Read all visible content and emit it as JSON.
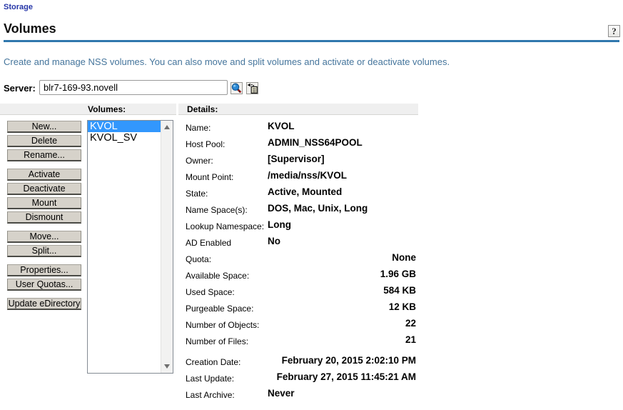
{
  "page": {
    "breadcrumb": "Storage",
    "title": "Volumes",
    "help_label": "?",
    "description": "Create and manage NSS volumes. You can also move and split volumes and activate or deactivate volumes."
  },
  "server": {
    "label": "Server:",
    "value": "blr7-169-93.novell",
    "search_icon": "magnifier-object-selector-icon",
    "history_icon": "object-history-icon"
  },
  "panel": {
    "volumes_header": "Volumes:",
    "details_header": "Details:"
  },
  "actions": {
    "groups": [
      [
        "New...",
        "Delete",
        "Rename..."
      ],
      [
        "Activate",
        "Deactivate",
        "Mount",
        "Dismount"
      ],
      [
        "Move...",
        "Split..."
      ],
      [
        "Properties...",
        "User Quotas..."
      ],
      [
        "Update eDirectory"
      ]
    ]
  },
  "volume_list": {
    "items": [
      {
        "name": "KVOL",
        "selected": true
      },
      {
        "name": "KVOL_SV",
        "selected": false
      }
    ]
  },
  "details": {
    "rows": [
      {
        "label": "Name:",
        "value": "KVOL",
        "align": "left"
      },
      {
        "label": "Host Pool:",
        "value": "ADMIN_NSS64POOL",
        "align": "left"
      },
      {
        "label": "Owner:",
        "value": "[Supervisor]",
        "align": "left"
      },
      {
        "label": "Mount Point:",
        "value": "/media/nss/KVOL",
        "align": "left"
      },
      {
        "label": "State:",
        "value": "Active, Mounted",
        "align": "left"
      },
      {
        "label": "Name Space(s):",
        "value": "DOS, Mac, Unix, Long",
        "align": "left"
      },
      {
        "label": "Lookup Namespace:",
        "value": "Long",
        "align": "left"
      },
      {
        "label": "AD Enabled",
        "value": "No",
        "align": "left"
      },
      {
        "label": "Quota:",
        "value": "None",
        "align": "right"
      },
      {
        "label": "Available Space:",
        "value": "1.96 GB",
        "align": "right"
      },
      {
        "label": "Used Space:",
        "value": "584 KB",
        "align": "right"
      },
      {
        "label": "Purgeable Space:",
        "value": "12 KB",
        "align": "right"
      },
      {
        "label": "Number of Objects:",
        "value": "22",
        "align": "right"
      },
      {
        "label": "Number of Files:",
        "value": "21",
        "align": "right"
      },
      {
        "label": "Creation Date:",
        "value": "February 20, 2015 2:02:10 PM",
        "align": "right",
        "gap": true
      },
      {
        "label": "Last Update:",
        "value": "February 27, 2015 11:45:21 AM",
        "align": "right"
      },
      {
        "label": "Last Archive:",
        "value": "Never",
        "align": "left"
      }
    ]
  },
  "colors": {
    "accent_rule": "#3077ad",
    "selection": "#3297fd",
    "link": "#2636a8",
    "description_text": "#45759c"
  }
}
